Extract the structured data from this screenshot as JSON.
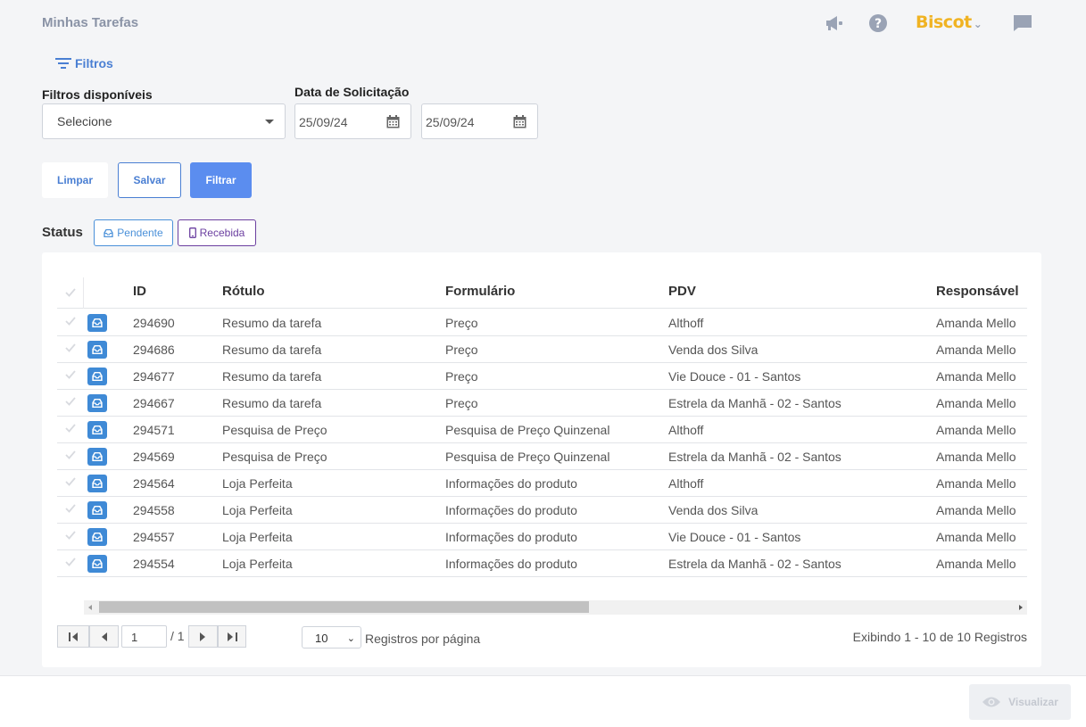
{
  "header": {
    "title": "Minhas Tarefas",
    "brand": "Biscot",
    "icons": [
      "megaphone-icon",
      "help-icon",
      "chat-icon"
    ]
  },
  "filters": {
    "toggle_label": "Filtros",
    "available_label": "Filtros disponíveis",
    "select_placeholder": "Selecione",
    "date_label": "Data de Solicitação",
    "date_from": "25/09/24",
    "date_to": "25/09/24",
    "buttons": {
      "clear": "Limpar",
      "save": "Salvar",
      "filter": "Filtrar"
    }
  },
  "status": {
    "label": "Status",
    "chips": [
      {
        "label": "Pendente",
        "color": "#4a90d9"
      },
      {
        "label": "Recebida",
        "color": "#6b3fa0"
      }
    ]
  },
  "table": {
    "columns": [
      "ID",
      "Rótulo",
      "Formulário",
      "PDV",
      "Responsável"
    ],
    "rows": [
      {
        "id": "294690",
        "rotulo": "Resumo da tarefa",
        "formulario": "Preço",
        "pdv": "Althoff",
        "responsavel": "Amanda Mello"
      },
      {
        "id": "294686",
        "rotulo": "Resumo da tarefa",
        "formulario": "Preço",
        "pdv": "Venda dos Silva",
        "responsavel": "Amanda Mello"
      },
      {
        "id": "294677",
        "rotulo": "Resumo da tarefa",
        "formulario": "Preço",
        "pdv": "Vie Douce - 01 - Santos",
        "responsavel": "Amanda Mello"
      },
      {
        "id": "294667",
        "rotulo": "Resumo da tarefa",
        "formulario": "Preço",
        "pdv": "Estrela da Manhã - 02 - Santos",
        "responsavel": "Amanda Mello"
      },
      {
        "id": "294571",
        "rotulo": "Pesquisa de Preço",
        "formulario": "Pesquisa de Preço Quinzenal",
        "pdv": "Althoff",
        "responsavel": "Amanda Mello"
      },
      {
        "id": "294569",
        "rotulo": "Pesquisa de Preço",
        "formulario": "Pesquisa de Preço Quinzenal",
        "pdv": "Estrela da Manhã - 02 - Santos",
        "responsavel": "Amanda Mello"
      },
      {
        "id": "294564",
        "rotulo": "Loja Perfeita",
        "formulario": "Informações do produto",
        "pdv": "Althoff",
        "responsavel": "Amanda Mello"
      },
      {
        "id": "294558",
        "rotulo": "Loja Perfeita",
        "formulario": "Informações do produto",
        "pdv": "Venda dos Silva",
        "responsavel": "Amanda Mello"
      },
      {
        "id": "294557",
        "rotulo": "Loja Perfeita",
        "formulario": "Informações do produto",
        "pdv": "Vie Douce - 01 - Santos",
        "responsavel": "Amanda Mello"
      },
      {
        "id": "294554",
        "rotulo": "Loja Perfeita",
        "formulario": "Informações do produto",
        "pdv": "Estrela da Manhã - 02 - Santos",
        "responsavel": "Amanda Mello"
      }
    ]
  },
  "pagination": {
    "current_page": "1",
    "total_pages": "/ 1",
    "per_page": "10",
    "per_page_label": "Registros por página",
    "summary": "Exibindo 1 - 10 de 10 Registros"
  },
  "footer": {
    "view_button": "Visualizar"
  }
}
